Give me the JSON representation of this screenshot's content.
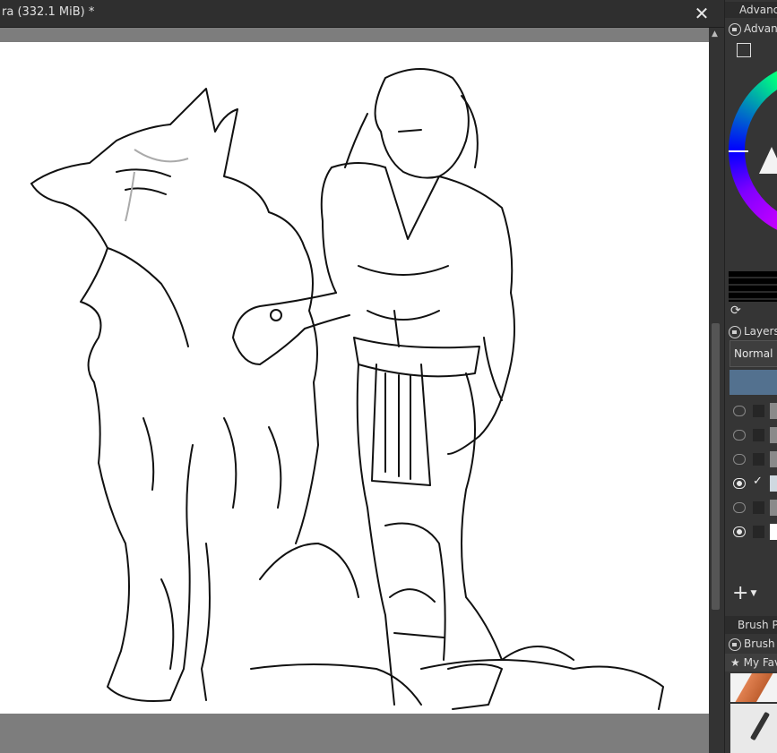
{
  "window": {
    "title": "ra (332.1 MiB) *",
    "close_glyph": "✕"
  },
  "docker": {
    "advanced_header": "Advance",
    "advanced_color_title": "Advan",
    "layers_title": "Layers",
    "blend_mode": "Normal",
    "brush_presets_header": "Brush Pre",
    "brush_title": "Brush",
    "tag": "My Fav",
    "layers": [
      {
        "visible": false,
        "selected": false
      },
      {
        "visible": false,
        "selected": false
      },
      {
        "visible": false,
        "selected": false
      },
      {
        "visible": true,
        "selected": true
      },
      {
        "visible": false,
        "selected": false
      },
      {
        "visible": true,
        "selected": false
      }
    ],
    "add_layer_glyph": "+"
  },
  "colors": {
    "selection": "#53718f",
    "background": "#3a3a3a",
    "canvas_margin": "#7d7d7d"
  }
}
